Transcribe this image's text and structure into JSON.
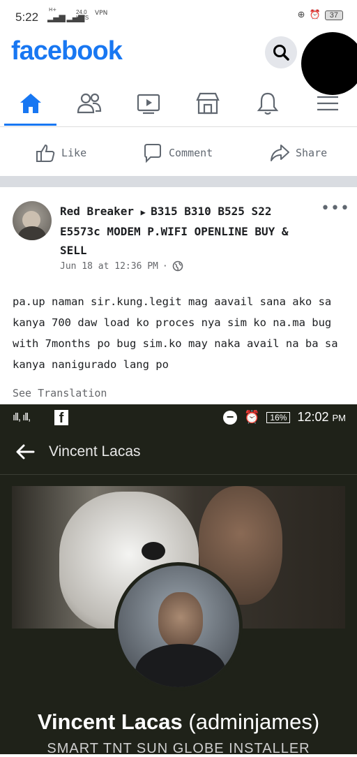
{
  "status_bar": {
    "time": "5:22",
    "signal_label": "H+",
    "speed_value": "24.0",
    "speed_unit": "KB/S",
    "vpn": "VPN",
    "battery": "37"
  },
  "header": {
    "brand": "facebook"
  },
  "nav": {
    "items": [
      "home-icon",
      "friends-icon",
      "watch-icon",
      "marketplace-icon",
      "notifications-icon",
      "menu-icon"
    ],
    "active_color": "#1877f2"
  },
  "post_actions": {
    "like": "Like",
    "comment": "Comment",
    "share": "Share"
  },
  "post": {
    "author": "Red Breaker",
    "group": "B315 B310 B525 S22 E5573c MODEM P.WIFI OPENLINE BUY & SELL",
    "timestamp": "Jun 18 at 12:36 PM",
    "body": "pa.up naman sir.kung.legit mag aavail sana ako sa kanya 700 daw load ko proces nya sim ko na.ma bug with 7months po bug sim.ko may naka avail na ba sa kanya nanigurado lang po",
    "see_translation": "See Translation"
  },
  "embedded_screenshot": {
    "battery": "16%",
    "time": "12:02",
    "ampm": "PM",
    "page_title": "Vincent Lacas",
    "profile_name": "Vincent Lacas",
    "profile_handle": "(adminjames)",
    "profile_subtitle": "SMART TNT SUN GLOBE INSTALLER"
  }
}
